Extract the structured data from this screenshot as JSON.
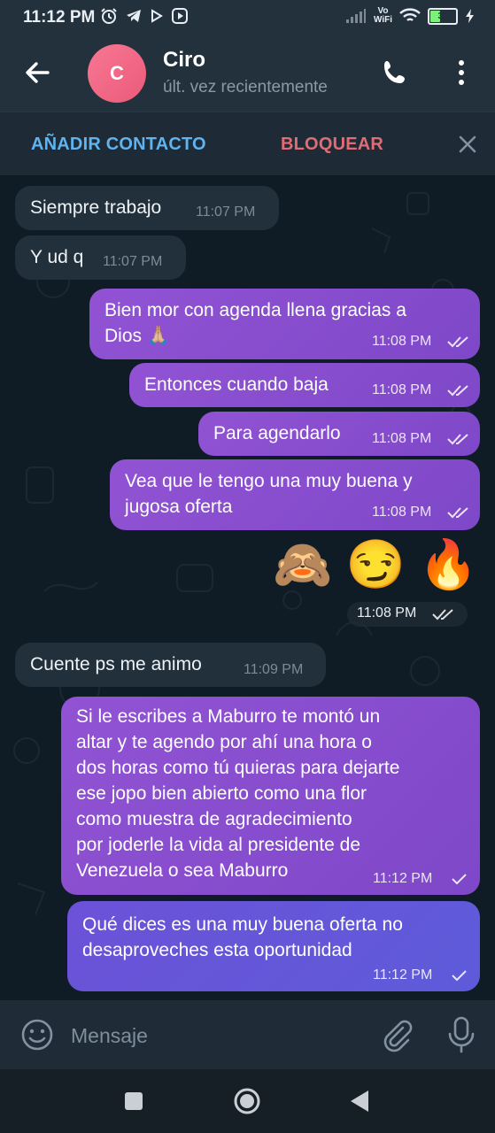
{
  "status_bar": {
    "time": "11:12 PM",
    "vo_wifi_top": "Vo",
    "vo_wifi_bottom": "WiFi",
    "battery": "37",
    "battery_level": 0.37,
    "icons": [
      "alarm-icon",
      "telegram-icon",
      "play-icon",
      "media-icon",
      "signal-icon",
      "wifi-icon",
      "battery-icon",
      "charging-icon"
    ]
  },
  "header": {
    "avatar_letter": "C",
    "name": "Ciro",
    "status": "últ. vez recientemente"
  },
  "action_bar": {
    "add_contact": "AÑADIR CONTACTO",
    "block": "BLOQUEAR"
  },
  "messages": [
    {
      "direction": "in",
      "text": "Siempre trabajo",
      "time": "11:07 PM"
    },
    {
      "direction": "in",
      "text": "Y ud q",
      "time": "11:07 PM"
    },
    {
      "direction": "out",
      "text": "Bien mor con agenda llena gracias a\nDios 🙏🏼",
      "time": "11:08 PM",
      "read": true
    },
    {
      "direction": "out",
      "text": "Entonces cuando baja",
      "time": "11:08 PM",
      "read": true
    },
    {
      "direction": "out",
      "text": "Para agendarlo",
      "time": "11:08 PM",
      "read": true
    },
    {
      "direction": "out",
      "text": "Vea que le tengo una muy buena y\njugosa oferta",
      "time": "11:08 PM",
      "read": true
    },
    {
      "direction": "out",
      "emojis": "🙈 😏 🔥",
      "time": "11:08 PM",
      "read": true
    },
    {
      "direction": "in",
      "text": "Cuente ps me animo",
      "time": "11:09 PM"
    },
    {
      "direction": "out",
      "text": "Si le escribes a Maburro te montó un\naltar y te agendo por ahí una hora o\ndos horas como tú quieras para dejarte\nese jopo bien abierto como una flor\ncomo muestra de agradecimiento\npor joderle la vida al presidente de\nVenezuela o sea Maburro",
      "time": "11:12 PM",
      "read": false
    },
    {
      "direction": "out",
      "text": "Qué dices es una muy buena oferta no\ndesaproveches esta oportunidad",
      "time": "11:12 PM",
      "read": false
    }
  ],
  "input_bar": {
    "placeholder": "Mensaje"
  },
  "colors": {
    "header_bg": "#23313d",
    "chat_bg": "#101c25",
    "incoming_bubble": "#22303b",
    "outgoing_bubble": "#8a4fd0",
    "outgoing_bubble_last": "#6457d9",
    "add_contact": "#5eb3f0",
    "block": "#e06c75",
    "avatar": "#f06e8a"
  }
}
